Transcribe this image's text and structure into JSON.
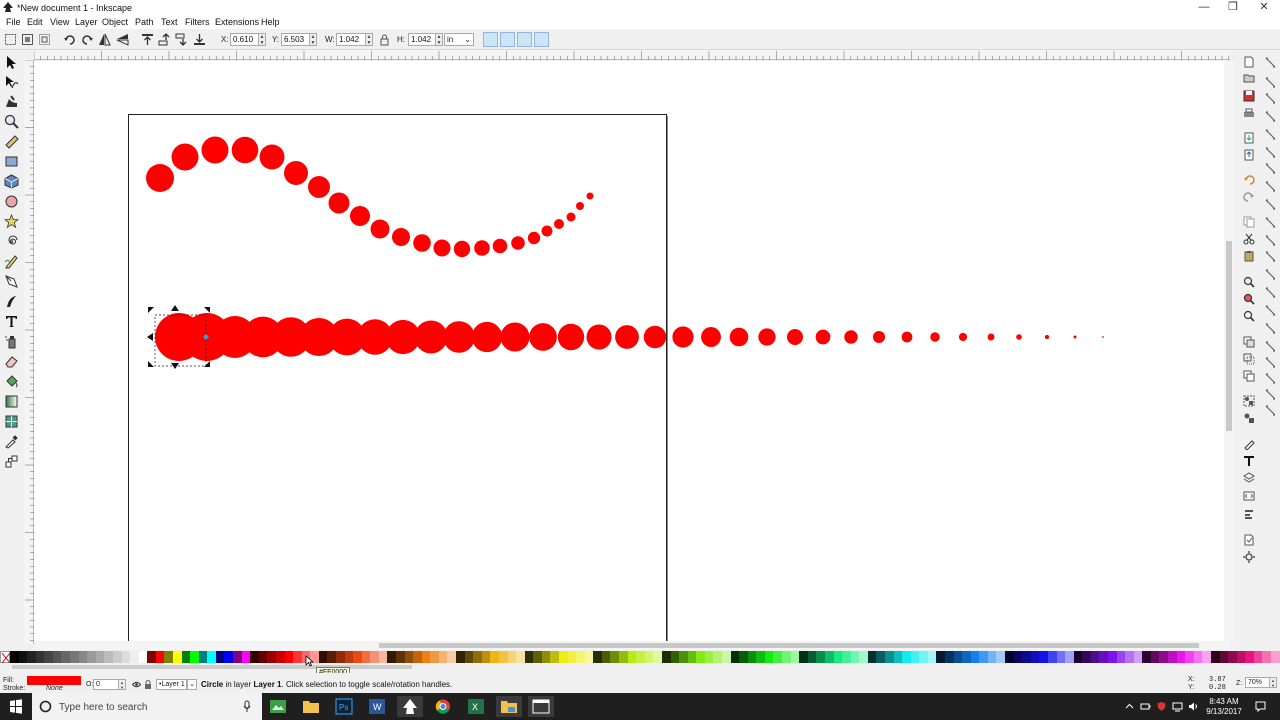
{
  "window": {
    "title": "*New document 1 - Inkscape",
    "controls": [
      "—",
      "❐",
      "✕"
    ]
  },
  "menu": [
    "File",
    "Edit",
    "View",
    "Layer",
    "Object",
    "Path",
    "Text",
    "Filters",
    "Extensions",
    "Help"
  ],
  "selector_controls": {
    "x_label": "X:",
    "x_value": "0.610",
    "y_label": "Y:",
    "y_value": "6.503",
    "w_label": "W:",
    "w_value": "1.042",
    "h_label": "H:",
    "h_value": "1.042",
    "unit": "in"
  },
  "tools": [
    "selector-tool",
    "node-tool",
    "tweak-tool",
    "zoom-tool",
    "measure-tool",
    "rectangle-tool",
    "3d-box-tool",
    "ellipse-tool",
    "star-tool",
    "spiral-tool",
    "pencil-tool",
    "pen-tool",
    "calligraphy-tool",
    "text-tool",
    "spray-tool",
    "eraser-tool",
    "paint-bucket-tool",
    "gradient-tool",
    "mesh-tool",
    "dropper-tool",
    "connector-tool"
  ],
  "canvas": {
    "fill_color": "#ff0000",
    "wave_circles": 30,
    "row_circles": 34
  },
  "palette": {
    "tooltip": "#FF0000"
  },
  "status": {
    "fill_label": "Fill:",
    "stroke_label": "Stroke:",
    "stroke_value": "None",
    "opacity_label": "O:",
    "opacity_value": "0",
    "layer_name": "•Layer 1",
    "message_object": "Circle",
    "message_middle": " in layer ",
    "message_layer": "Layer 1",
    "message_end": ". Click selection to toggle scale/rotation handles.",
    "x_label": "X:",
    "x_value": "3.87",
    "y_label": "Y:",
    "y_value": "0.28",
    "zoom_label": "Z:",
    "zoom_value": "70%"
  },
  "taskbar": {
    "search_placeholder": "Type here to search",
    "time": "8:43 AM",
    "date": "9/13/2017"
  }
}
